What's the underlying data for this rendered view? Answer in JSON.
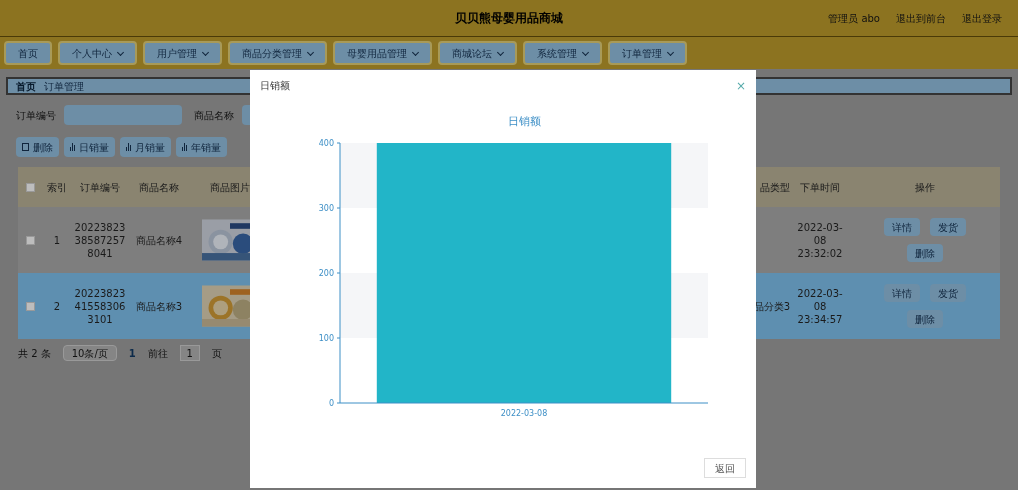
{
  "header": {
    "title": "贝贝熊母婴用品商城",
    "user": "管理员 abo",
    "links": [
      "退出到前台",
      "退出登录"
    ]
  },
  "nav": [
    {
      "label": "首页",
      "caret": false
    },
    {
      "label": "个人中心",
      "caret": true
    },
    {
      "label": "用户管理",
      "caret": true
    },
    {
      "label": "商品分类管理",
      "caret": true
    },
    {
      "label": "母婴用品管理",
      "caret": true
    },
    {
      "label": "商城论坛",
      "caret": true
    },
    {
      "label": "系统管理",
      "caret": true
    },
    {
      "label": "订单管理",
      "caret": true
    }
  ],
  "breadcrumb": [
    "首页",
    "订单管理"
  ],
  "search": [
    {
      "label": "订单编号"
    },
    {
      "label": "商品名称"
    }
  ],
  "actions": [
    {
      "kind": "delete",
      "label": "删除"
    },
    {
      "kind": "chart",
      "label": "日销量"
    },
    {
      "kind": "chart",
      "label": "月销量"
    },
    {
      "kind": "chart",
      "label": "年销量"
    }
  ],
  "table": {
    "all_selected": false,
    "columns": [
      "索引",
      "订单编号",
      "商品名称",
      "商品图片",
      "品类型",
      "下单时间",
      "操作"
    ],
    "rows": [
      {
        "selected": false,
        "index": "1",
        "order_no": "20223823385872578041",
        "name": "商品名称4",
        "image": {
          "kind": "picture"
        },
        "type": "",
        "time": "2022-03-08 23:32:02",
        "buttons": [
          "详情",
          "发货",
          "删除"
        ]
      },
      {
        "selected": true,
        "index": "2",
        "order_no": "20223823415583063101",
        "name": "商品名称3",
        "image": {
          "kind": "picture"
        },
        "type": "品分类3",
        "time": "2022-03-08 23:34:57",
        "buttons": [
          "详情",
          "发货",
          "删除"
        ]
      }
    ]
  },
  "pagination": {
    "total": "共 2 条",
    "page_size": "10条/页",
    "pages": [
      {
        "label": "1",
        "selected": true
      }
    ],
    "goto_label": "前往",
    "goto_value": "1",
    "goto_unit": "页"
  },
  "dialog": {
    "title": "日销额",
    "close": "×",
    "return_button": "返回",
    "chart_data": {
      "type": "bar",
      "title": "日销额",
      "categories": [
        "2022-03-08"
      ],
      "series": [
        {
          "color": "#22b5c8",
          "values": [
            400
          ]
        }
      ],
      "ylim": [
        0,
        400
      ],
      "yticks": [
        0,
        100,
        200,
        300,
        400
      ]
    }
  }
}
